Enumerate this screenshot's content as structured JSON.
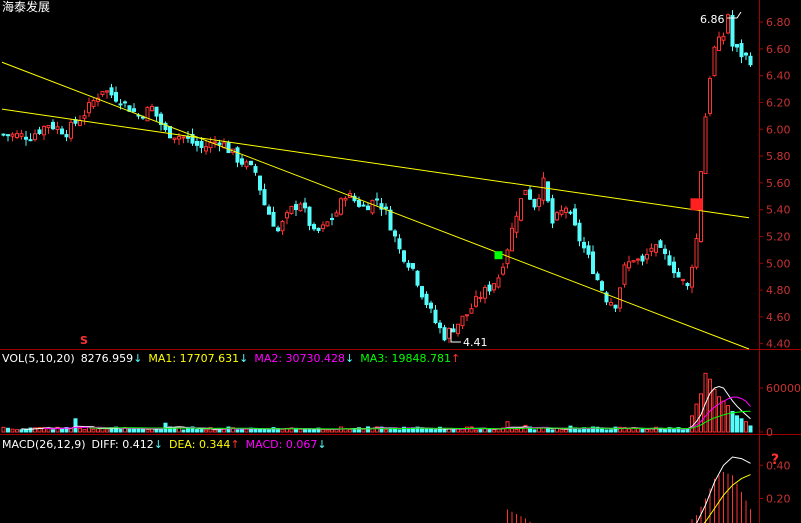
{
  "stock_title": "海泰发展",
  "colors": {
    "up": "#ff3232",
    "down": "#54fcfc",
    "frame": "#a00000",
    "axis_text": "#c83232",
    "trend": "#ffff00",
    "ma1": "#ffffff",
    "ma2": "#ff00ff",
    "ma3": "#00ff00",
    "dea": "#ffff00",
    "diff": "#ffffff",
    "marker_buy": "#00ff00",
    "marker_red": "#ff2020"
  },
  "price_panel": {
    "yticks": [
      "6.80",
      "6.60",
      "6.40",
      "6.20",
      "6.00",
      "5.80",
      "5.60",
      "5.40",
      "5.20",
      "5.00",
      "4.80",
      "4.60",
      "4.40"
    ],
    "high_label": "6.86",
    "low_label": "4.41",
    "s_marker": "S"
  },
  "vol_panel": {
    "title": "VOL(5,10,20)",
    "value": "8276.959",
    "value_arrow": "↓",
    "ma1_text": "MA1: 17707.631",
    "ma1_arrow": "↓",
    "ma2_text": "MA2: 30730.428",
    "ma2_arrow": "↓",
    "ma3_text": "MA3: 19848.781",
    "ma3_arrow": "↑",
    "yticks": [
      "60000",
      "0"
    ]
  },
  "macd_panel": {
    "title": "MACD(26,12,9)",
    "diff_text": "DIFF: 0.412",
    "diff_arrow": "↓",
    "dea_text": "DEA: 0.344",
    "dea_arrow": "↑",
    "macd_text": "MACD: 0.067",
    "macd_arrow": "↓",
    "yticks": [
      "0.40",
      "0.20"
    ],
    "question_mark": "?"
  },
  "chart_data": {
    "type": "candlestick",
    "title": "海泰发展",
    "price_axis": {
      "ylim": [
        4.36,
        6.92
      ],
      "ticks": [
        6.8,
        6.6,
        6.4,
        6.2,
        6.0,
        5.8,
        5.6,
        5.4,
        5.2,
        5.0,
        4.8,
        4.6,
        4.4
      ]
    },
    "high": 6.86,
    "low": 4.41,
    "price_path": [
      [
        0,
        5.96
      ],
      [
        6,
        5.95
      ],
      [
        10,
        6.04
      ],
      [
        14,
        5.98
      ],
      [
        18,
        6.12
      ],
      [
        22,
        6.3
      ],
      [
        26,
        6.22
      ],
      [
        30,
        6.1
      ],
      [
        33,
        6.16
      ],
      [
        36,
        5.98
      ],
      [
        40,
        5.94
      ],
      [
        44,
        5.86
      ],
      [
        48,
        5.92
      ],
      [
        52,
        5.78
      ],
      [
        56,
        5.68
      ],
      [
        58,
        5.44
      ],
      [
        61,
        5.24
      ],
      [
        64,
        5.4
      ],
      [
        66,
        5.46
      ],
      [
        69,
        5.22
      ],
      [
        71,
        5.26
      ],
      [
        74,
        5.38
      ],
      [
        76,
        5.52
      ],
      [
        80,
        5.42
      ],
      [
        83,
        5.48
      ],
      [
        85,
        5.38
      ],
      [
        88,
        5.1
      ],
      [
        91,
        4.96
      ],
      [
        93,
        4.78
      ],
      [
        96,
        4.56
      ],
      [
        98,
        4.46
      ],
      [
        100,
        4.52
      ],
      [
        103,
        4.62
      ],
      [
        106,
        4.76
      ],
      [
        108,
        4.82
      ],
      [
        110,
        4.9
      ],
      [
        112,
        5.12
      ],
      [
        114,
        5.38
      ],
      [
        116,
        5.56
      ],
      [
        118,
        5.44
      ],
      [
        120,
        5.6
      ],
      [
        122,
        5.3
      ],
      [
        125,
        5.42
      ],
      [
        128,
        5.18
      ],
      [
        130,
        5.04
      ],
      [
        132,
        4.88
      ],
      [
        134,
        4.74
      ],
      [
        136,
        4.7
      ],
      [
        138,
        4.96
      ],
      [
        140,
        5.04
      ],
      [
        142,
        5.0
      ],
      [
        144,
        5.12
      ],
      [
        146,
        5.08
      ],
      [
        148,
        5.02
      ],
      [
        150,
        4.9
      ],
      [
        152,
        4.82
      ],
      [
        154,
        5.18
      ],
      [
        155,
        5.7
      ],
      [
        156,
        6.1
      ],
      [
        157,
        6.4
      ],
      [
        158,
        6.6
      ],
      [
        160,
        6.7
      ],
      [
        161,
        6.86
      ],
      [
        162,
        6.62
      ],
      [
        164,
        6.56
      ],
      [
        166,
        6.52
      ]
    ],
    "trendlines": [
      {
        "from": [
          0,
          6.5
        ],
        "to": [
          166,
          4.36
        ]
      },
      {
        "from": [
          0,
          6.15
        ],
        "to": [
          166,
          5.34
        ]
      }
    ],
    "markers": [
      {
        "i": 110,
        "price": 5.06,
        "kind": "buy"
      },
      {
        "i": 154,
        "price": 5.44,
        "kind": "red"
      }
    ],
    "volume": {
      "ylim": [
        0,
        90000
      ],
      "last": 8276.959,
      "ma1": 17707.631,
      "ma2": 30730.428,
      "ma3": 19848.781,
      "spikes": [
        [
          16,
          18000
        ],
        [
          36,
          12000
        ],
        [
          112,
          14000
        ],
        [
          116,
          9000
        ],
        [
          126,
          8000
        ],
        [
          150,
          6000
        ],
        [
          153,
          22000
        ],
        [
          154,
          38000
        ],
        [
          155,
          52000
        ],
        [
          156,
          80000
        ],
        [
          157,
          72000
        ],
        [
          158,
          58000
        ],
        [
          159,
          48000
        ],
        [
          160,
          42000
        ],
        [
          161,
          36000
        ],
        [
          162,
          28000
        ],
        [
          163,
          22000
        ],
        [
          164,
          18000
        ],
        [
          165,
          14000
        ],
        [
          166,
          8276.959
        ]
      ]
    },
    "macd": {
      "ylim": [
        -0.05,
        0.48
      ],
      "diff": 0.412,
      "dea": 0.344,
      "macd": 0.067,
      "diff_path": [
        [
          104,
          -0.06
        ],
        [
          110,
          0.0
        ],
        [
          116,
          0.02
        ],
        [
          120,
          0.02
        ],
        [
          124,
          -0.02
        ],
        [
          150,
          -0.05
        ],
        [
          154,
          0.05
        ],
        [
          156,
          0.16
        ],
        [
          158,
          0.3
        ],
        [
          160,
          0.4
        ],
        [
          162,
          0.45
        ],
        [
          164,
          0.44
        ],
        [
          166,
          0.412
        ]
      ],
      "dea_path": [
        [
          112,
          -0.06
        ],
        [
          118,
          0.0
        ],
        [
          124,
          0.0
        ],
        [
          150,
          -0.05
        ],
        [
          154,
          0.0
        ],
        [
          156,
          0.06
        ],
        [
          158,
          0.14
        ],
        [
          160,
          0.22
        ],
        [
          162,
          0.28
        ],
        [
          164,
          0.32
        ],
        [
          166,
          0.344
        ]
      ]
    }
  }
}
